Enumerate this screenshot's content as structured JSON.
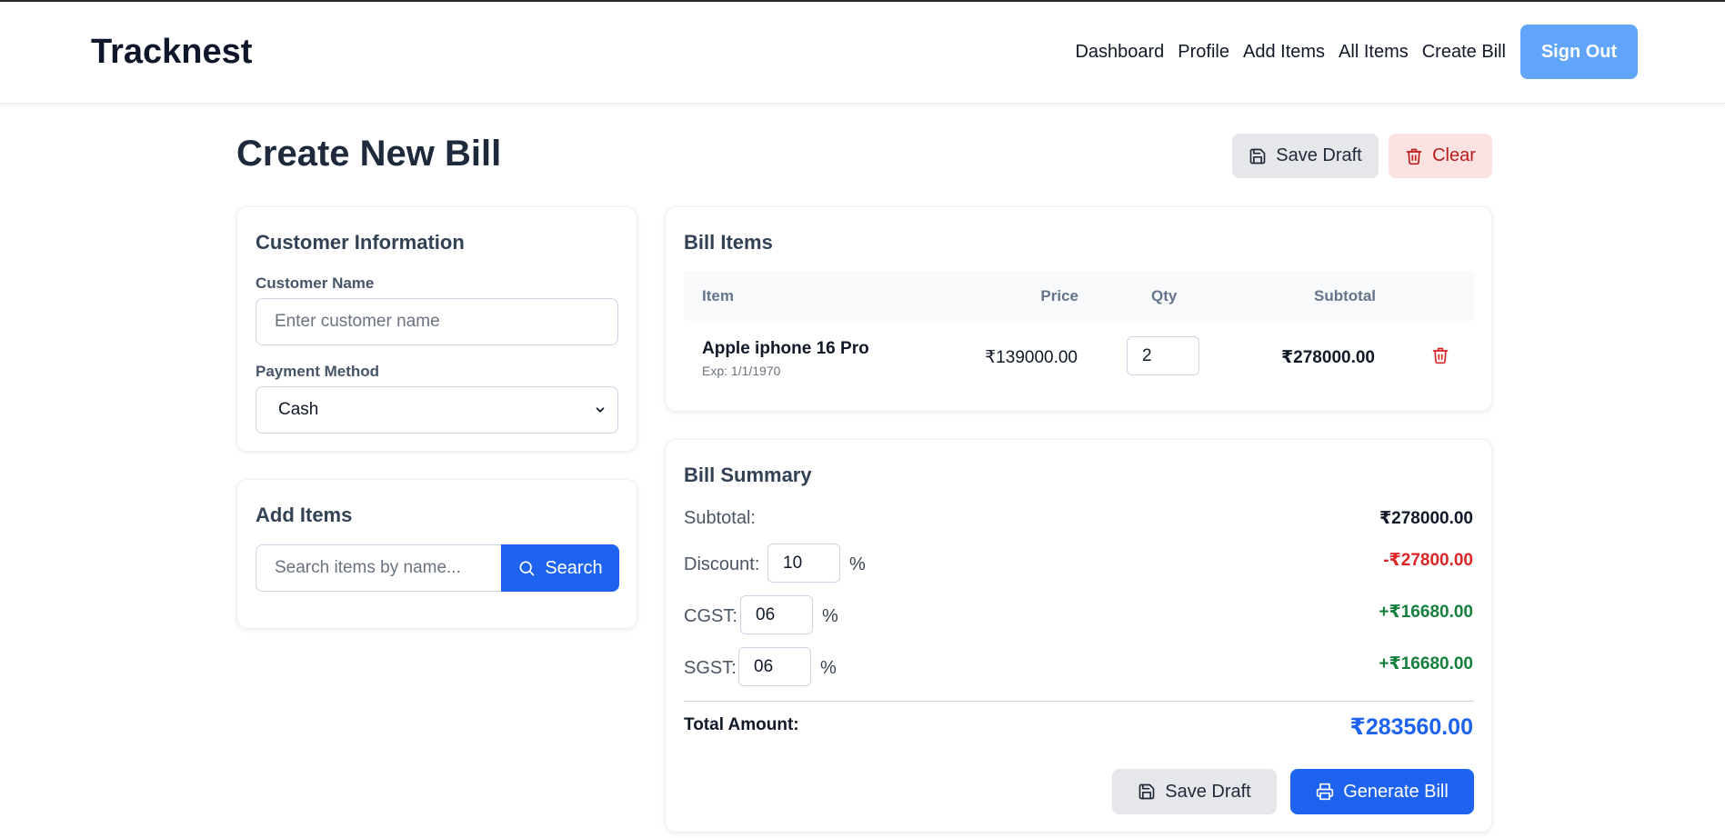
{
  "navbar": {
    "brand": "Tracknest",
    "links": [
      "Dashboard",
      "Profile",
      "Add Items",
      "All Items",
      "Create Bill"
    ],
    "signout_label": "Sign Out"
  },
  "page": {
    "title": "Create New Bill",
    "save_draft_label": "Save Draft",
    "clear_label": "Clear"
  },
  "customer": {
    "title": "Customer Information",
    "name_label": "Customer Name",
    "name_placeholder": "Enter customer name",
    "name_value": "",
    "payment_label": "Payment Method",
    "payment_selected": "Cash"
  },
  "add_items": {
    "title": "Add Items",
    "search_placeholder": "Search items by name...",
    "search_label": "Search"
  },
  "bill_items": {
    "title": "Bill Items",
    "columns": [
      "Item",
      "Price",
      "Qty",
      "Subtotal"
    ],
    "rows": [
      {
        "name": "Apple iphone 16 Pro",
        "exp": "Exp: 1/1/1970",
        "price": "₹139000.00",
        "qty": "2",
        "subtotal": "₹278000.00"
      }
    ]
  },
  "summary": {
    "title": "Bill Summary",
    "subtotal_label": "Subtotal:",
    "subtotal_value": "₹278000.00",
    "discount_label": "Discount:",
    "discount_input": "10",
    "discount_value": "-₹27800.00",
    "cgst_label": "CGST:",
    "cgst_input": "06",
    "cgst_value": "+₹16680.00",
    "sgst_label": "SGST:",
    "sgst_input": "06",
    "sgst_value": "+₹16680.00",
    "percent_symbol": "%",
    "total_label": "Total Amount:",
    "total_value": "₹283560.00",
    "save_draft_label": "Save Draft",
    "generate_label": "Generate Bill"
  },
  "colors": {
    "primary": "#1d63f0",
    "signout": "#60a5fa",
    "danger": "#dc2626",
    "success": "#15803d"
  }
}
